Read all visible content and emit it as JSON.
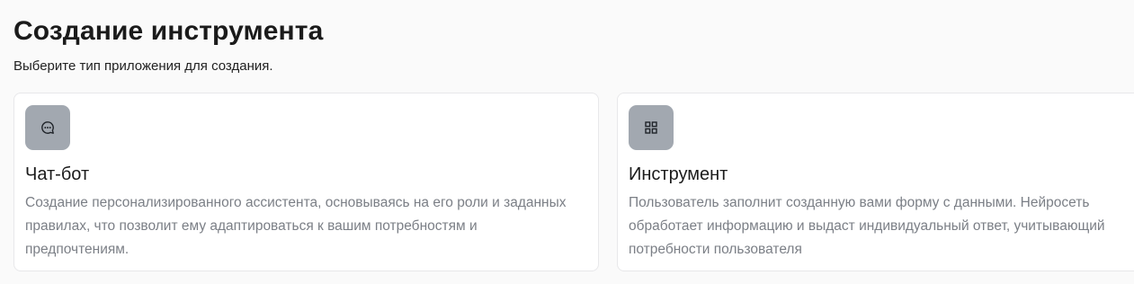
{
  "header": {
    "title": "Создание инструмента",
    "subtitle": "Выберите тип приложения для создания."
  },
  "cards": [
    {
      "icon": "chat-bubble-icon",
      "title": "Чат-бот",
      "description": "Создание персонализированного ассистента, основываясь на его роли и заданных правилах, что позволит ему адаптироваться к вашим потребностям и предпочтениям."
    },
    {
      "icon": "grid-icon",
      "title": "Инструмент",
      "description": "Пользователь заполнит созданную вами форму с данными. Нейросеть обработает информацию и выдаст индивидуальный ответ, учитывающий потребности пользователя"
    }
  ],
  "colors": {
    "icon_box": "#a2a8b0",
    "card_border": "#e8e8ea",
    "description_text": "#7b7f86"
  }
}
